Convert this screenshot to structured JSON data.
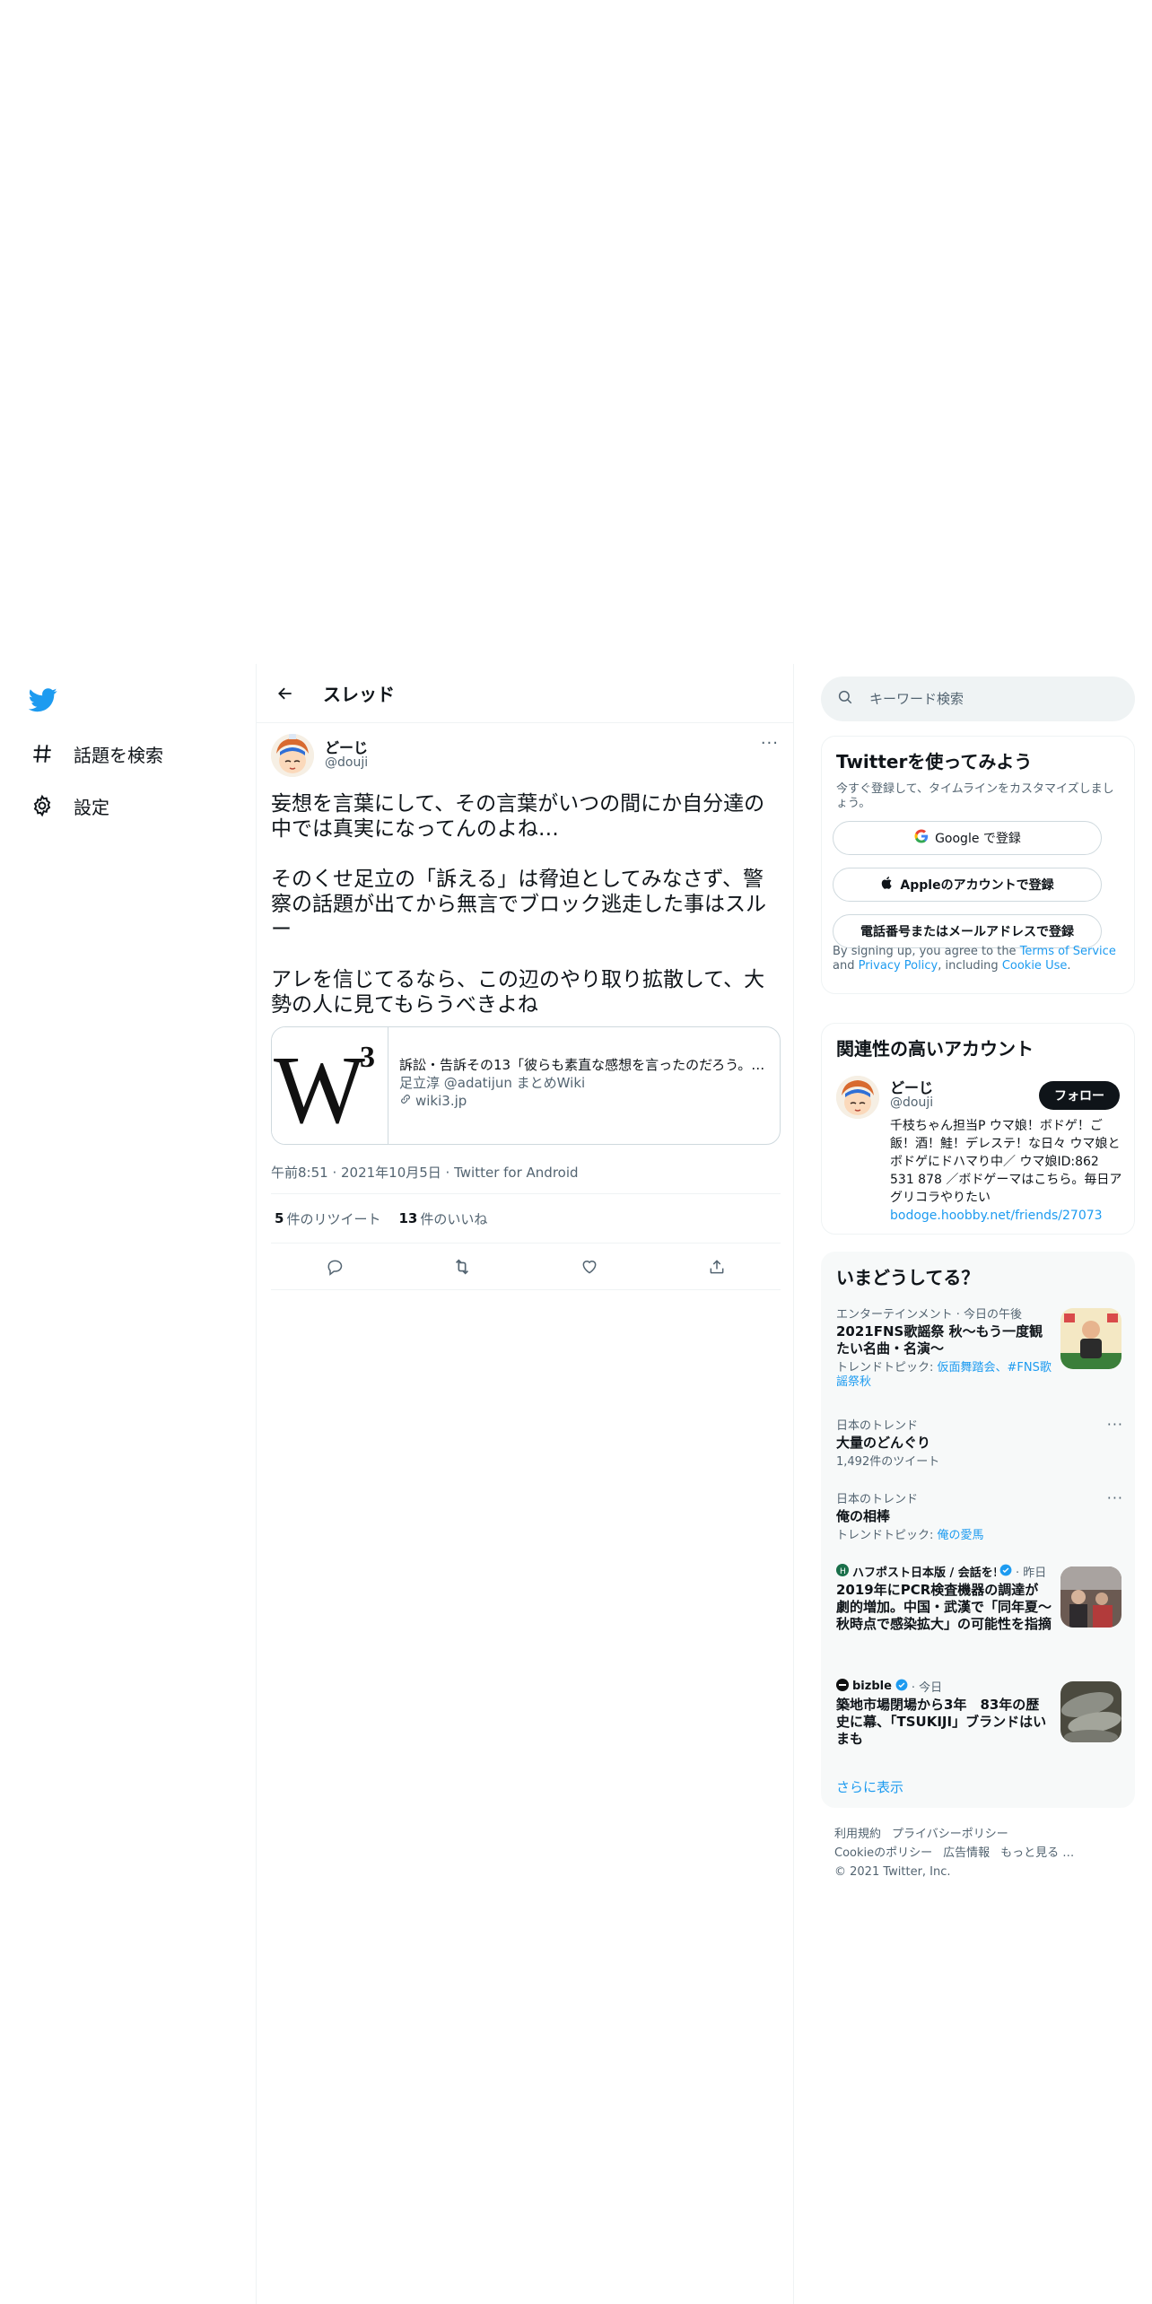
{
  "nav": {
    "explore_label": "話題を検索",
    "settings_label": "設定"
  },
  "main": {
    "title": "スレッド"
  },
  "tweet": {
    "author_name": "どーじ",
    "author_handle": "@douji",
    "more": "···",
    "text": "妄想を言葉にして、その言葉がいつの間にか自分達の中では真実になってんのよね…\n\nそのくせ足立の「訴える」は脅迫としてみなさず、警察の話題が出てから無言でブロック逃走した事はスルー\n\nアレを信じてるなら、この辺のやり取り拡散して、大勢の人に見てもらうべきよね",
    "card": {
      "title": "訴訟・告訴その13「彼らも素直な感想を言ったのだろう。…",
      "description": "足立淳 @adatijun まとめWiki",
      "domain": "wiki3.jp"
    },
    "meta": "午前8:51 · 2021年10月5日 · Twitter for Android",
    "retweets_count": "5",
    "retweets_label": "件のリツイート",
    "likes_count": "13",
    "likes_label": "件のいいね"
  },
  "search": {
    "placeholder": "キーワード検索"
  },
  "signup": {
    "title": "Twitterを使ってみよう",
    "subtitle": "今すぐ登録して、タイムラインをカスタマイズしましょう。",
    "google_label": "Google で登録",
    "apple_label": "Appleのアカウントで登録",
    "phone_label": "電話番号またはメールアドレスで登録",
    "legal_1": "By signing up, you agree to the ",
    "terms": "Terms of Service",
    "legal_2": " and ",
    "privacy": "Privacy Policy",
    "legal_3": ", including ",
    "cookie": "Cookie Use",
    "legal_4": "."
  },
  "related": {
    "title": "関連性の高いアカウント",
    "name": "どーじ",
    "handle": "@douji",
    "follow_label": "フォロー",
    "bio": "千枝ちゃん担当P ウマ娘！ボドゲ！ご飯！酒！鮭！デレステ！な日々 ウマ娘とボドゲにドハマり中／ ウマ娘ID:862 531 878 ／ボドゲーマはこちら。毎日アグリコラやりたい",
    "link": "bodoge.hoobby.net/friends/27073"
  },
  "trends": {
    "title": "いまどうしてる？",
    "items": [
      {
        "context": "エンターテインメント · 今日の午後",
        "title": "2021FNS歌謡祭 秋～もう一度観たい名曲・名演～",
        "sub_label": "トレンドトピック: ",
        "sub_link": "仮面舞踏会、#FNS歌謡祭秋"
      },
      {
        "context": "日本のトレンド",
        "title": "大量のどんぐり",
        "sub": "1,492件のツイート"
      },
      {
        "context": "日本のトレンド",
        "title": "俺の相棒",
        "sub_label": "トレンドトピック: ",
        "sub_link": "俺の愛馬"
      },
      {
        "source": "ハフポスト日本版 / 会話を!",
        "time": "· 昨日",
        "title": "2019年にPCR検査機器の調達が劇的増加。中国・武漢で「同年夏～秋時点で感染拡大」の可能性を指摘"
      },
      {
        "source": "bizble",
        "time": "· 今日",
        "title": "築地市場閉場から3年　83年の歴史に幕、「TSUKIJI」ブランドはいまも"
      }
    ],
    "show_more": "さらに表示"
  },
  "footer": {
    "terms": "利用規約",
    "privacy": "プライバシーポリシー",
    "cookie": "Cookieのポリシー",
    "ads": "広告情報",
    "more": "もっと見る …",
    "copyright": "© 2021 Twitter, Inc."
  },
  "colors": {
    "accent": "#1d9bf0",
    "text": "#0f1419",
    "secondary": "#536471",
    "border": "#eff3f4"
  }
}
